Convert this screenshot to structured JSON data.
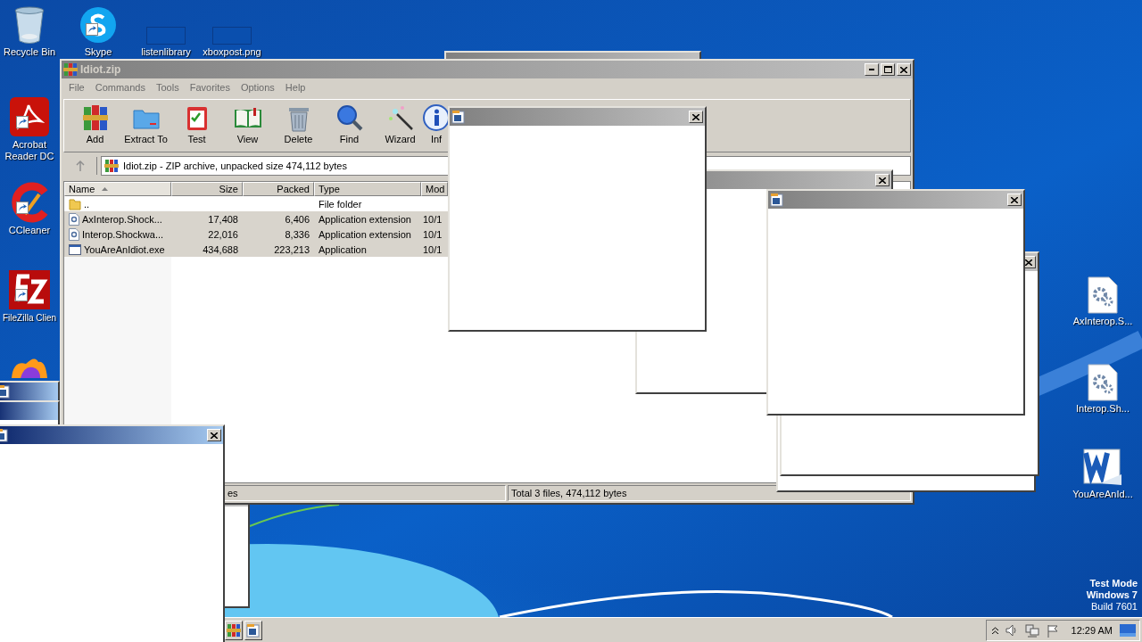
{
  "desktop_icons": [
    {
      "label": "Recycle Bin",
      "kind": "recycle"
    },
    {
      "label": "Skype",
      "kind": "skype"
    },
    {
      "label": "listenlibrary",
      "kind": "blank"
    },
    {
      "label": "xboxpost.png",
      "kind": "blank"
    },
    {
      "label": "Acrobat Reader DC",
      "kind": "acrobat"
    },
    {
      "label": "CCleaner",
      "kind": "ccleaner"
    },
    {
      "label": "FileZilla Clien",
      "kind": "filezilla"
    },
    {
      "kind": "firefox"
    },
    {
      "label": "AxInterop.S...",
      "kind": "dll"
    },
    {
      "label": "Interop.Sh...",
      "kind": "dll"
    },
    {
      "label": "YouAreAnId...",
      "kind": "word"
    }
  ],
  "winrar": {
    "title": "Idiot.zip",
    "menu": [
      "File",
      "Commands",
      "Tools",
      "Favorites",
      "Options",
      "Help"
    ],
    "toolbar": [
      {
        "label": "Add",
        "kind": "add"
      },
      {
        "label": "Extract To",
        "kind": "extract"
      },
      {
        "label": "Test",
        "kind": "test"
      },
      {
        "label": "View",
        "kind": "view"
      },
      {
        "label": "Delete",
        "kind": "delete"
      },
      {
        "label": "Find",
        "kind": "find"
      },
      {
        "label": "Wizard",
        "kind": "wizard"
      },
      {
        "label": "Inf",
        "kind": "info"
      }
    ],
    "address": "Idiot.zip - ZIP archive, unpacked size 474,112 bytes",
    "columns": [
      {
        "label": "Name",
        "sorted": true
      },
      {
        "label": "Size",
        "sorted": false
      },
      {
        "label": "Packed",
        "sorted": false
      },
      {
        "label": "Type",
        "sorted": false
      },
      {
        "label": "Mod",
        "sorted": false
      }
    ],
    "rows": [
      {
        "name": "..",
        "type": "File folder",
        "kind": "folder",
        "selected": false
      },
      {
        "name": "AxInterop.Shock...",
        "size": "17,408",
        "packed": "6,406",
        "type": "Application extension",
        "modified": "10/1",
        "kind": "dll",
        "selected": true
      },
      {
        "name": "Interop.Shockwa...",
        "size": "22,016",
        "packed": "8,336",
        "type": "Application extension",
        "modified": "10/1",
        "kind": "dll",
        "selected": true
      },
      {
        "name": "YouAreAnIdiot.exe",
        "size": "434,688",
        "packed": "223,213",
        "type": "Application",
        "modified": "10/1",
        "kind": "exe",
        "selected": true
      }
    ],
    "status": [
      "es",
      "Total 3 files, 474,112 bytes"
    ]
  },
  "os_notice": [
    "Test Mode",
    "Windows 7",
    "Build 7601"
  ],
  "taskbar": {
    "clock": "12:29 AM"
  }
}
